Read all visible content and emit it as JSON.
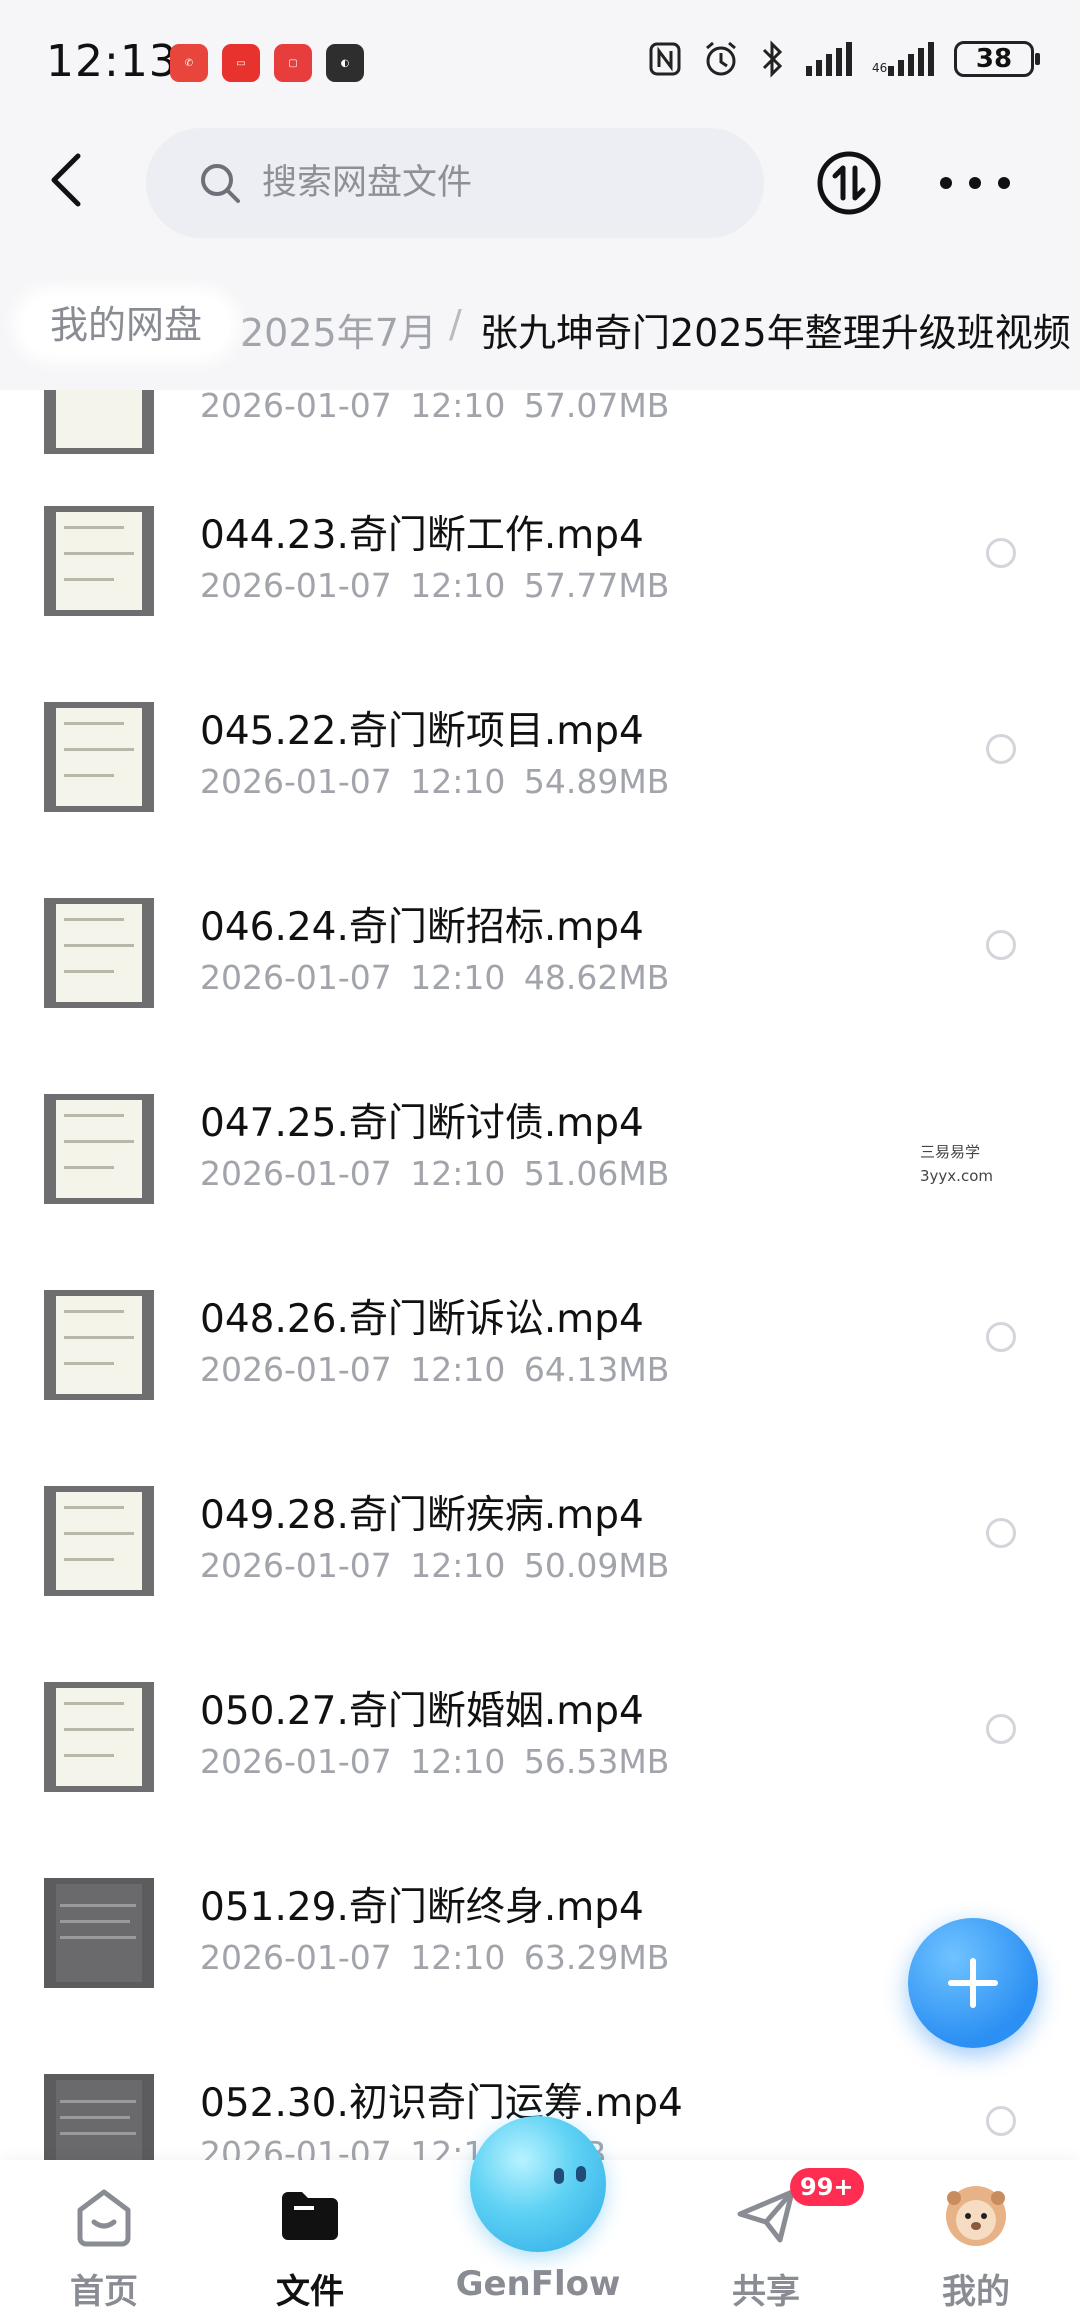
{
  "status_bar": {
    "time": "12:13",
    "battery": "38"
  },
  "header": {
    "search_placeholder": "搜索网盘文件"
  },
  "breadcrumb": {
    "root": "我的网盘",
    "middle": "2025年7月",
    "separator": "/",
    "current": "张九坤奇门2025年整理升级班视频"
  },
  "files": [
    {
      "name": "",
      "meta": "2026-01-07  12:10  57.07MB"
    },
    {
      "name": "044.23.奇门断工作.mp4",
      "meta": "2026-01-07  12:10  57.77MB"
    },
    {
      "name": "045.22.奇门断项目.mp4",
      "meta": "2026-01-07  12:10  54.89MB"
    },
    {
      "name": "046.24.奇门断招标.mp4",
      "meta": "2026-01-07  12:10  48.62MB"
    },
    {
      "name": "047.25.奇门断讨债.mp4",
      "meta": "2026-01-07  12:10  51.06MB"
    },
    {
      "name": "048.26.奇门断诉讼.mp4",
      "meta": "2026-01-07  12:10  64.13MB"
    },
    {
      "name": "049.28.奇门断疾病.mp4",
      "meta": "2026-01-07  12:10  50.09MB"
    },
    {
      "name": "050.27.奇门断婚姻.mp4",
      "meta": "2026-01-07  12:10  56.53MB"
    },
    {
      "name": "051.29.奇门断终身.mp4",
      "meta": "2026-01-07  12:10  63.29MB"
    },
    {
      "name": "052.30.初识奇门运筹.mp4",
      "meta": "2026-01-07  12:10  ...MB"
    }
  ],
  "watermark": {
    "line1": "三易易学",
    "line2": "3yyx.com"
  },
  "bottom_nav": {
    "home": "首页",
    "files": "文件",
    "genflow": "GenFlow",
    "share": "共享",
    "mine": "我的",
    "share_badge": "99+"
  },
  "colors": {
    "accent": "#2b8ff3",
    "badge": "#ff2d52",
    "muted_text": "#a2a4ab"
  }
}
